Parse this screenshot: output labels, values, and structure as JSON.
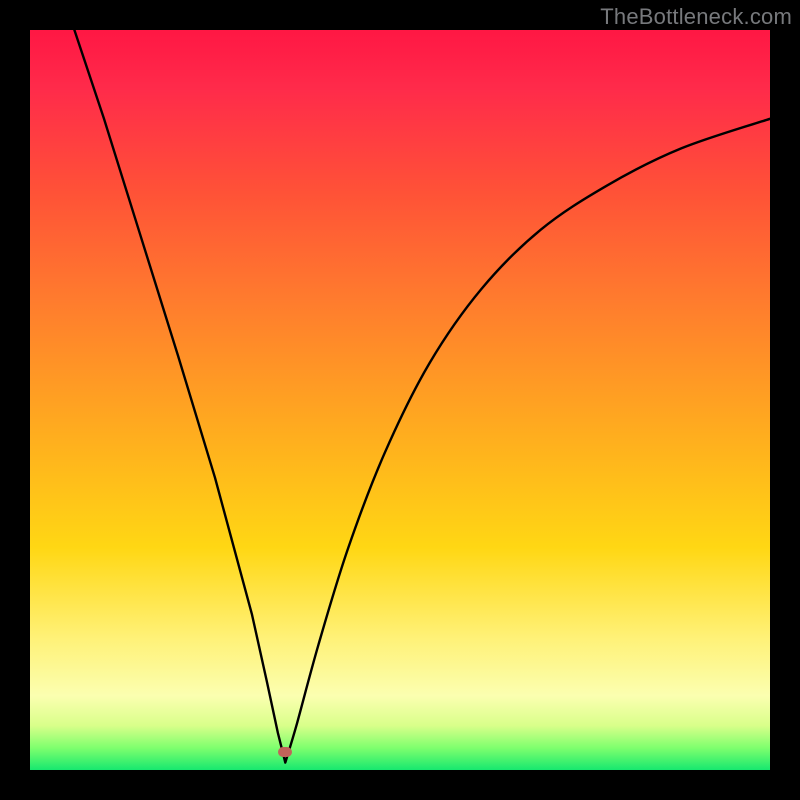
{
  "watermark": "TheBottleneck.com",
  "marker": {
    "x_frac": 0.345,
    "y_frac": 0.975
  },
  "chart_data": {
    "type": "line",
    "title": "",
    "xlabel": "",
    "ylabel": "",
    "xlim": [
      0,
      1
    ],
    "ylim": [
      0,
      1
    ],
    "series": [
      {
        "name": "bottleneck-curve-left",
        "x": [
          0.06,
          0.1,
          0.15,
          0.2,
          0.25,
          0.3,
          0.32,
          0.335,
          0.345
        ],
        "y": [
          1.0,
          0.88,
          0.72,
          0.56,
          0.395,
          0.21,
          0.12,
          0.05,
          0.01
        ]
      },
      {
        "name": "bottleneck-curve-right",
        "x": [
          0.345,
          0.36,
          0.39,
          0.43,
          0.48,
          0.54,
          0.61,
          0.69,
          0.78,
          0.88,
          1.0
        ],
        "y": [
          0.01,
          0.06,
          0.17,
          0.3,
          0.43,
          0.55,
          0.65,
          0.73,
          0.79,
          0.84,
          0.88
        ]
      }
    ],
    "gradient_stops": [
      {
        "pos": 0.0,
        "color": "#ff1744"
      },
      {
        "pos": 0.22,
        "color": "#ff5237"
      },
      {
        "pos": 0.55,
        "color": "#ffae1e"
      },
      {
        "pos": 0.82,
        "color": "#fff176"
      },
      {
        "pos": 0.94,
        "color": "#d9ff8a"
      },
      {
        "pos": 1.0,
        "color": "#17e86f"
      }
    ],
    "marker": {
      "x": 0.345,
      "y": 0.025,
      "color": "#c1635a"
    }
  }
}
